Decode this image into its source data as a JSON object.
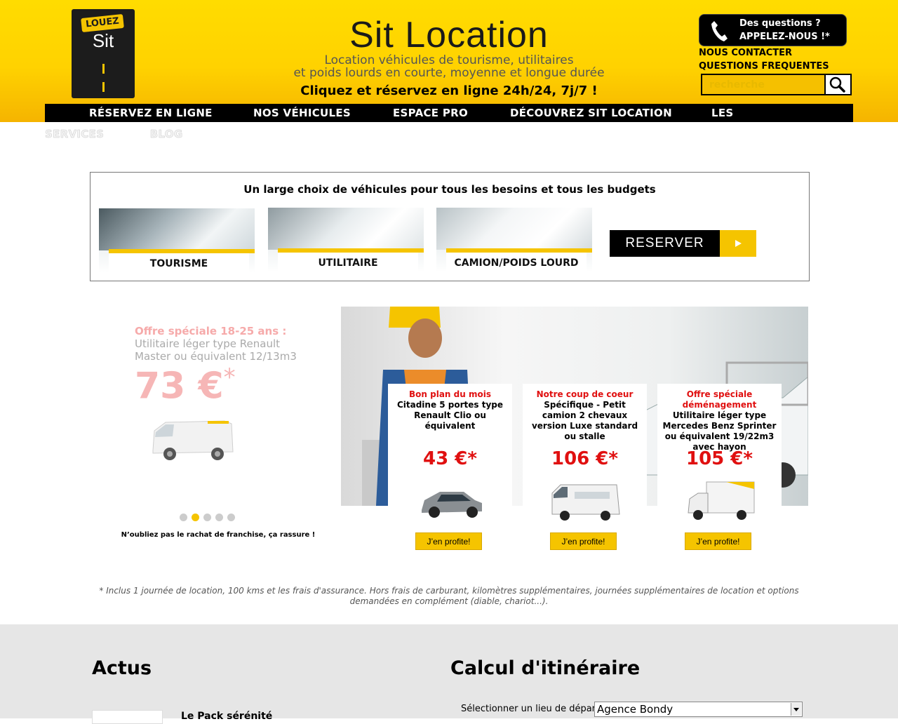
{
  "header": {
    "logo_top": "LOUEZ",
    "logo_main": "Sit",
    "site_title": "Sit Location",
    "tagline_line1": "Location véhicules de tourisme, utilitaires",
    "tagline_line2": "et poids lourds en courte, moyenne et longue durée",
    "cta": "Cliquez et réservez en ligne 24h/24, 7j/7 !",
    "phone_line1": "Des questions ?",
    "phone_line2": "APPELEZ-NOUS !*",
    "contact_link": "NOUS CONTACTER",
    "faq_link": "QUESTIONS FREQUENTES",
    "search_placeholder": "recherche"
  },
  "nav": {
    "items": [
      "RÉSERVEZ EN LIGNE",
      "NOS VÉHICULES",
      "ESPACE PRO",
      "DÉCOUVREZ SIT LOCATION",
      "LES"
    ],
    "overflow": [
      "SERVICES",
      "BLOG"
    ]
  },
  "choice": {
    "title": "Un large choix de véhicules pour tous les besoins et tous les budgets",
    "vehicles": [
      "TOURISME",
      "UTILITAIRE",
      "CAMION/POIDS LOURD"
    ],
    "reserve_label": "RESERVER"
  },
  "promo": {
    "title": "Offre spéciale 18-25 ans :",
    "description": "Utilitaire léger type Renault Master ou équivalent 12/13m3",
    "price": "73 €",
    "price_star": "*",
    "slides_total": 5,
    "slide_active": 2,
    "franchise_note": "N’oubliez pas le rachat de franchise, ça rassure !"
  },
  "offers": [
    {
      "title": "Bon plan du mois",
      "description": "Citadine 5 portes type Renault Clio ou équivalent",
      "price": "43 €*",
      "button": "J’en profite!"
    },
    {
      "title": "Notre coup de coeur",
      "description": "Spécifique - Petit camion 2 chevaux version Luxe standard ou stalle",
      "price": "106 €*",
      "button": "J’en profite!"
    },
    {
      "title": "Offre spéciale déménagement",
      "description": "Utilitaire léger type Mercedes Benz Sprinter ou équivalent 19/22m3 avec hayon",
      "price": "105 €*",
      "button": "J’en profite!"
    }
  ],
  "disclaimer": "* Inclus 1 journée de location, 100 kms et les frais d'assurance. Hors frais de carburant, kilomètres supplémentaires, journées supplémentaires de location et options demandées en complément (diable, chariot...).",
  "footer": {
    "actus_title": "Actus",
    "news_title": "Le Pack sérénité",
    "itinerary_title": "Calcul d'itinéraire",
    "departure_label": "Sélectionner un lieu de départ:",
    "departure_value": "Agence Bondy"
  },
  "colors": {
    "brand_yellow": "#ffd200",
    "offer_red": "#e01010",
    "nav_black": "#000000"
  }
}
